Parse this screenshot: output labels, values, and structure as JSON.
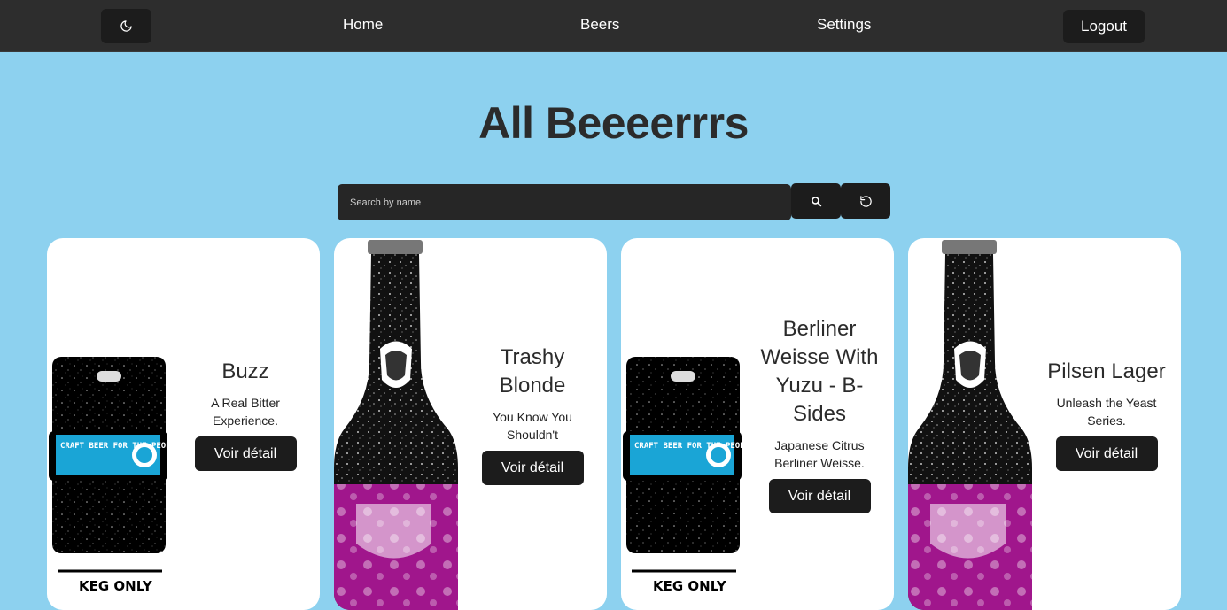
{
  "nav": {
    "theme_icon": "moon-icon",
    "home": "Home",
    "beers": "Beers",
    "settings": "Settings",
    "logout": "Logout"
  },
  "title": "All Beeeerrrs",
  "search": {
    "placeholder": "Search by name",
    "value": "",
    "search_icon": "search-icon",
    "reset_icon": "reset-icon"
  },
  "beers": [
    {
      "name": "Buzz",
      "tagline": "A Real Bitter Experience.",
      "button": "Voir détail",
      "image": "keg",
      "image_text": "CRAFT BEER FOR THE PEOPLE",
      "image_footer": "KEG ONLY"
    },
    {
      "name": "Trashy Blonde",
      "tagline": "You Know You Shouldn't",
      "button": "Voir détail",
      "image": "bottle"
    },
    {
      "name": "Berliner Weisse With Yuzu - B-Sides",
      "tagline": "Japanese Citrus Berliner Weisse.",
      "button": "Voir détail",
      "image": "keg",
      "image_text": "CRAFT BEER FOR THE PEOPLE",
      "image_footer": "KEG ONLY"
    },
    {
      "name": "Pilsen Lager",
      "tagline": "Unleash the Yeast Series.",
      "button": "Voir détail",
      "image": "bottle"
    }
  ],
  "colors": {
    "background": "#8dd1ef",
    "navbar": "#2d2d2d",
    "button": "#1c1c1c",
    "label_pink": "#a0168c",
    "label_blue": "#1aa5d6"
  }
}
